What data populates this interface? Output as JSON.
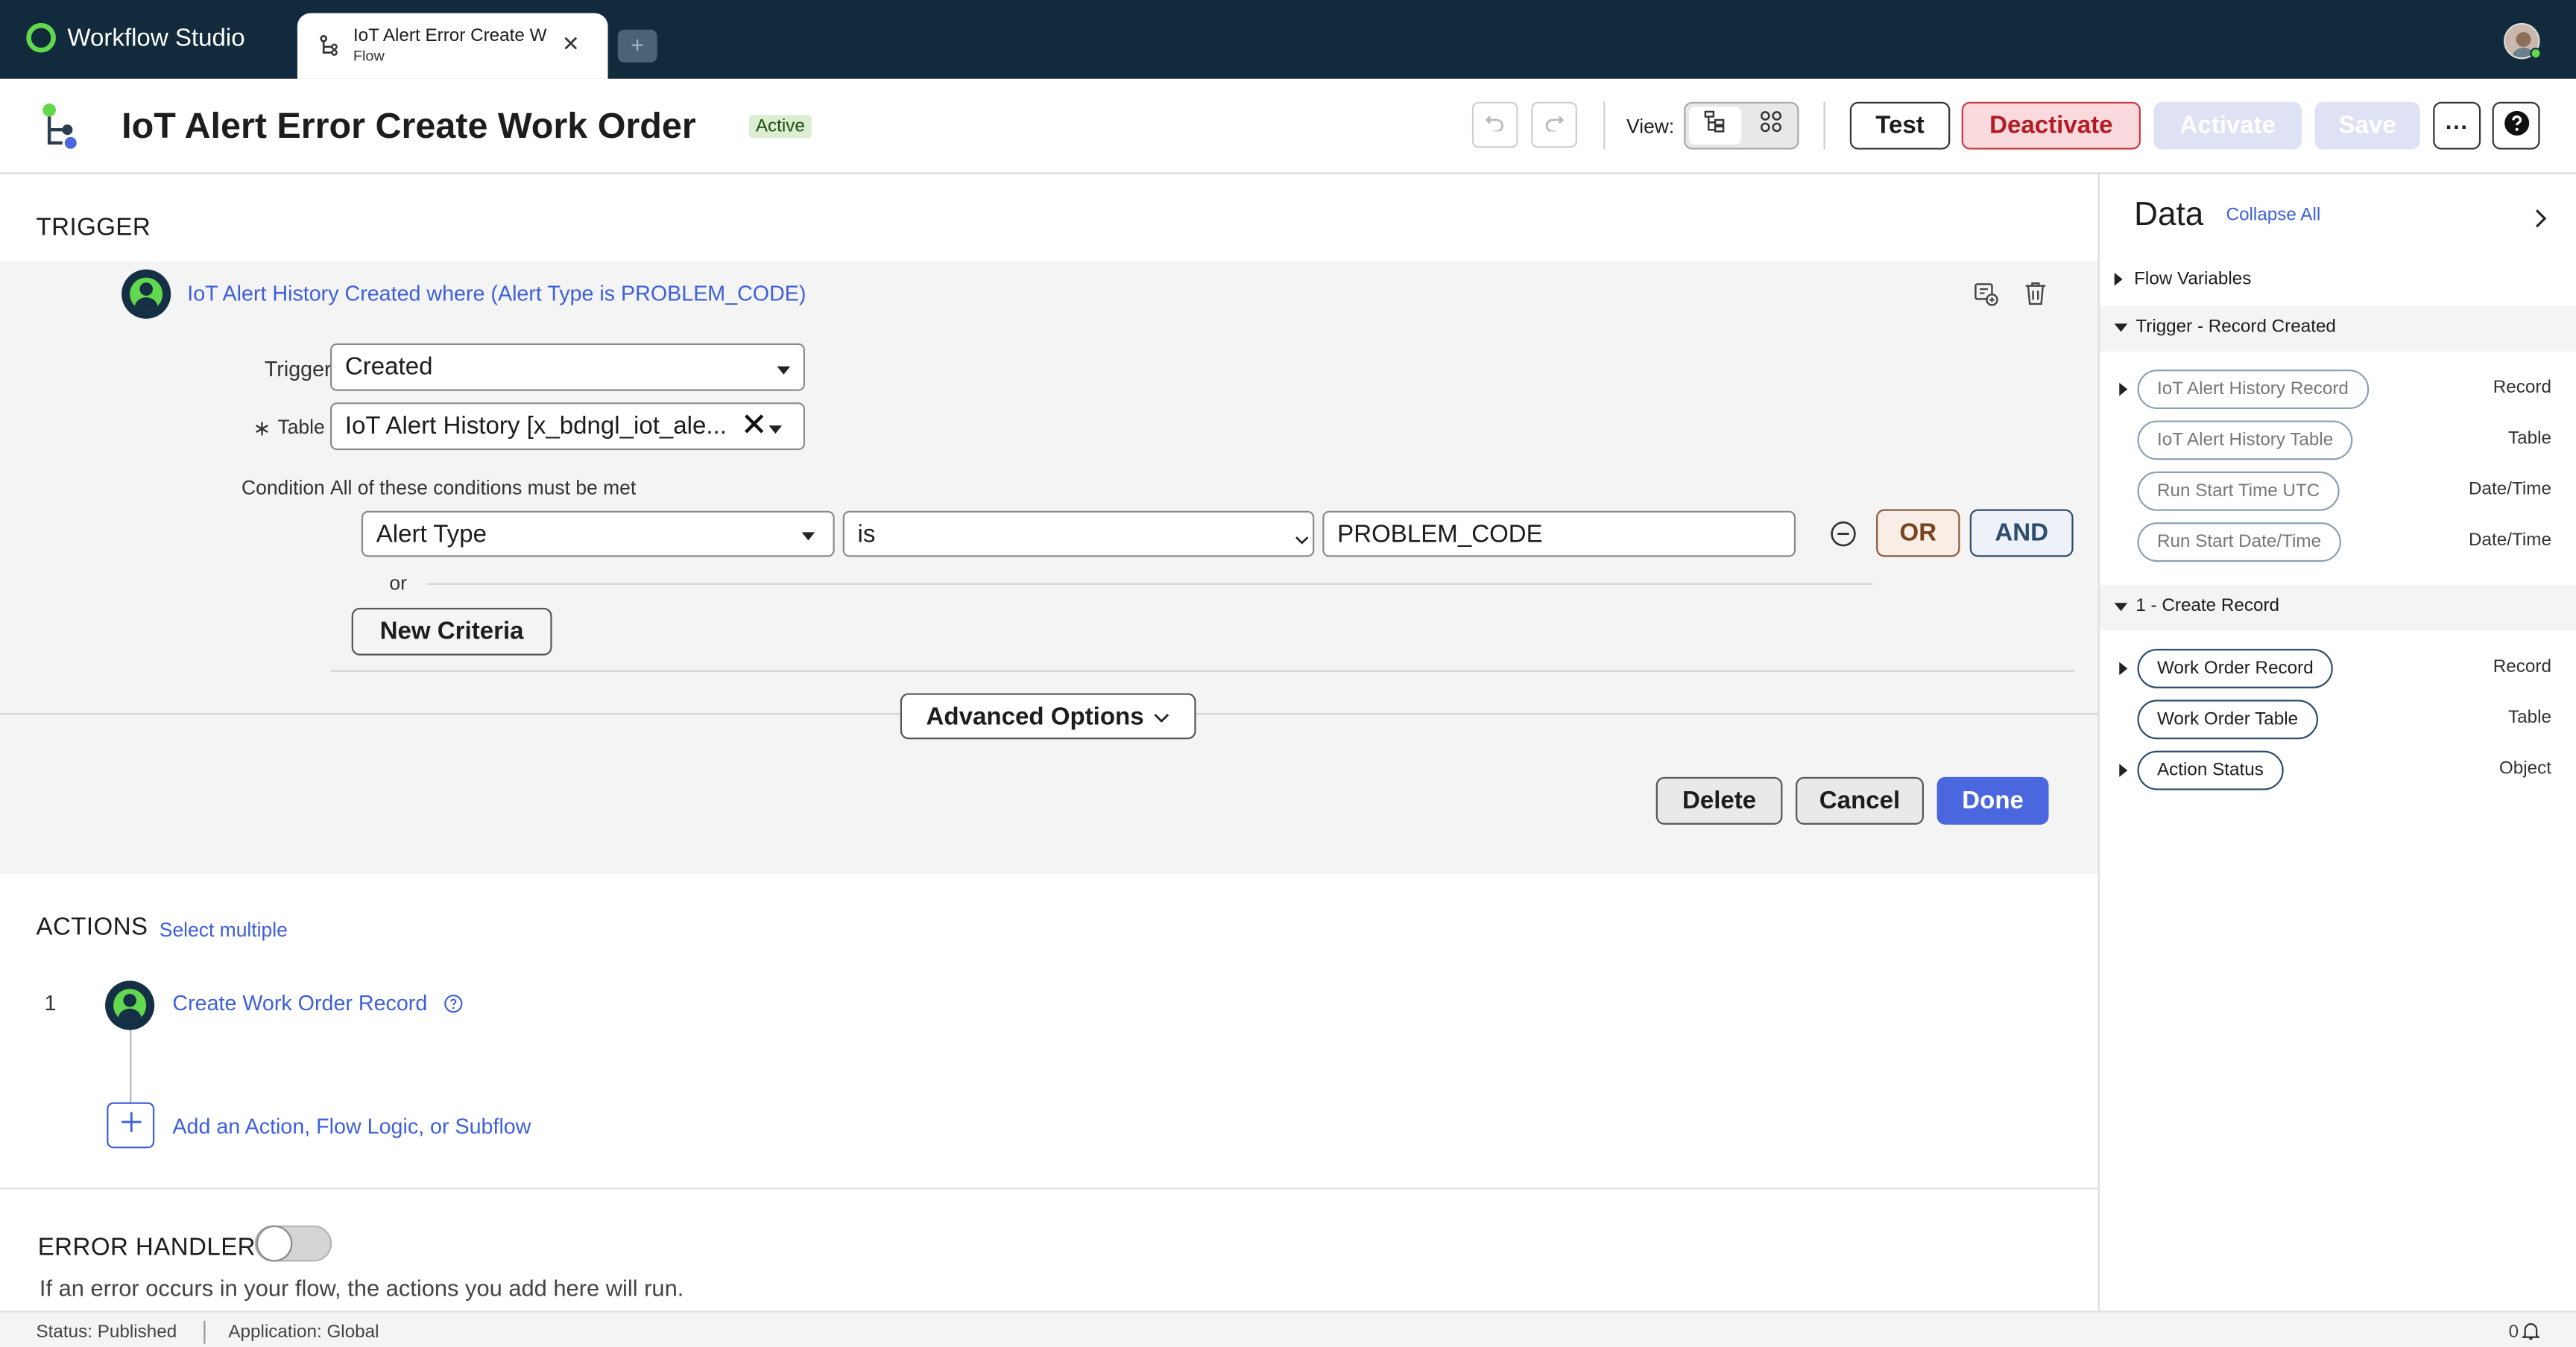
{
  "app": {
    "name": "Workflow Studio"
  },
  "tab": {
    "title": "IoT Alert Error Create W",
    "subtitle": "Flow",
    "close": "✕",
    "add": "+"
  },
  "header": {
    "title": "IoT Alert Error Create Work Order",
    "status": "Active",
    "view_label": "View:",
    "test": "Test",
    "deactivate": "Deactivate",
    "activate": "Activate",
    "save": "Save",
    "more": "···"
  },
  "trigger": {
    "section_title": "TRIGGER",
    "summary": "IoT Alert History Created where (Alert Type is PROBLEM_CODE)",
    "trigger_label": "Trigger",
    "trigger_value": "Created",
    "table_label": "Table",
    "table_required": "∗",
    "table_value": "IoT Alert History [x_bdngl_iot_ale...",
    "condition_label": "Condition",
    "condition_hint": "All of these conditions must be met",
    "field": "Alert Type",
    "operator": "is",
    "value": "PROBLEM_CODE",
    "or_btn": "OR",
    "and_btn": "AND",
    "or_text": "or",
    "new_criteria": "New Criteria",
    "advanced_options": "Advanced Options",
    "delete": "Delete",
    "cancel": "Cancel",
    "done": "Done"
  },
  "actions": {
    "section_title": "ACTIONS",
    "select_multiple": "Select multiple",
    "items": [
      {
        "number": "1",
        "label": "Create Work Order Record"
      }
    ],
    "add_label": "Add an Action, Flow Logic, or Subflow"
  },
  "error_handler": {
    "title": "ERROR HANDLER",
    "description": "If an error occurs in your flow, the actions you add here will run.",
    "enabled": false
  },
  "data_panel": {
    "title": "Data",
    "collapse_all": "Collapse All",
    "groups": [
      {
        "label": "Flow Variables",
        "expanded": false,
        "items": []
      },
      {
        "label": "Trigger - Record Created",
        "expanded": true,
        "items": [
          {
            "label": "IoT Alert History Record",
            "type": "Record",
            "expandable": true
          },
          {
            "label": "IoT Alert History Table",
            "type": "Table",
            "expandable": false
          },
          {
            "label": "Run Start Time UTC",
            "type": "Date/Time",
            "expandable": false
          },
          {
            "label": "Run Start Date/Time",
            "type": "Date/Time",
            "expandable": false
          }
        ]
      },
      {
        "label": "1 - Create Record",
        "expanded": true,
        "items": [
          {
            "label": "Work Order Record",
            "type": "Record",
            "expandable": true
          },
          {
            "label": "Work Order Table",
            "type": "Table",
            "expandable": false
          },
          {
            "label": "Action Status",
            "type": "Object",
            "expandable": true
          }
        ]
      }
    ]
  },
  "status_bar": {
    "status": "Status: Published",
    "application": "Application: Global",
    "notifications": "0"
  },
  "colors": {
    "accent": "#4a67e0",
    "brand_green": "#62d84e",
    "topbar": "#122b3c",
    "danger": "#c8383f"
  }
}
